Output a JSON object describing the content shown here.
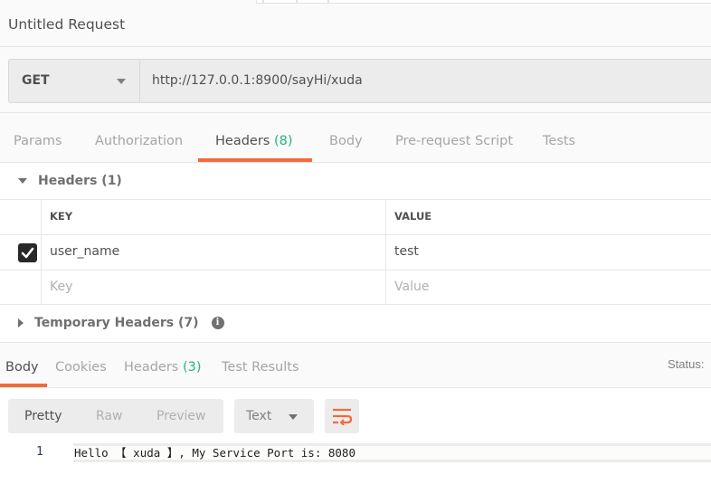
{
  "request": {
    "title": "Untitled Request",
    "method": "GET",
    "url": "http://127.0.0.1:8900/sayHi/xuda"
  },
  "request_tabs": [
    {
      "label": "Params",
      "count": null,
      "active": false
    },
    {
      "label": "Authorization",
      "count": null,
      "active": false
    },
    {
      "label": "Headers",
      "count": "(8)",
      "active": true
    },
    {
      "label": "Body",
      "count": null,
      "active": false
    },
    {
      "label": "Pre-request Script",
      "count": null,
      "active": false
    },
    {
      "label": "Tests",
      "count": null,
      "active": false
    }
  ],
  "headers_section": {
    "label": "Headers",
    "count": "(1)",
    "expanded": true,
    "columns": {
      "key": "KEY",
      "value": "VALUE"
    },
    "rows": [
      {
        "checked": true,
        "key": "user_name",
        "value": "test"
      }
    ],
    "placeholder": {
      "key": "Key",
      "value": "Value"
    }
  },
  "temporary_headers": {
    "label": "Temporary Headers",
    "count": "(7)",
    "expanded": false,
    "info_icon": "info-icon"
  },
  "response_tabs": [
    {
      "label": "Body",
      "count": null,
      "active": true
    },
    {
      "label": "Cookies",
      "count": null,
      "active": false
    },
    {
      "label": "Headers",
      "count": "(3)",
      "active": false
    },
    {
      "label": "Test Results",
      "count": null,
      "active": false
    }
  ],
  "response": {
    "status_label": "Status:",
    "view_modes": [
      "Pretty",
      "Raw",
      "Preview"
    ],
    "active_view": "Pretty",
    "format": "Text",
    "wrap_icon": "wrap-lines-icon",
    "lines": [
      {
        "number": "1",
        "text": "Hello 【 xuda 】, My Service Port is: 8080"
      }
    ]
  },
  "colors": {
    "accent": "#f26b3a",
    "count_green": "#26b47f",
    "checkbox": "#282828"
  }
}
